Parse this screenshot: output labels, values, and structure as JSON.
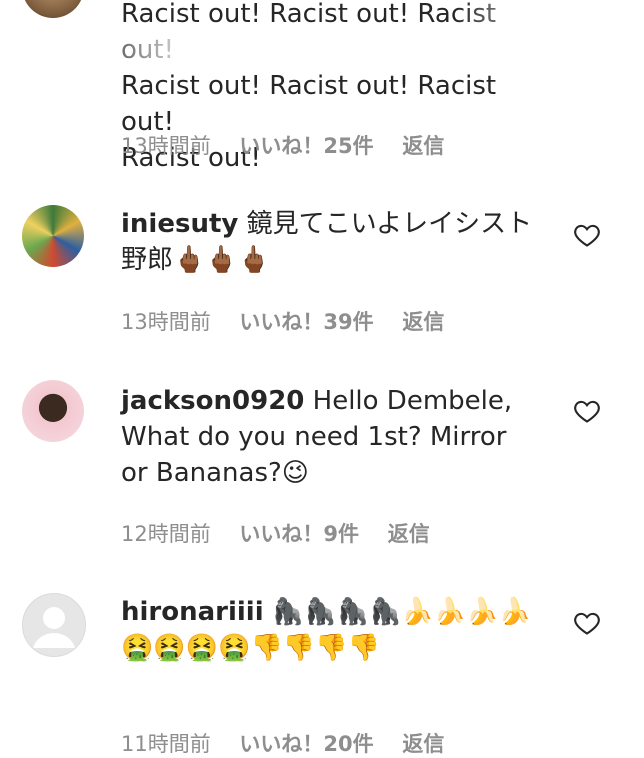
{
  "comments": [
    {
      "lines": [
        "Racist out! Racist out! Racist out!",
        "Racist out! Racist out! Racist out!",
        "Racist out!"
      ],
      "time": "13時間前",
      "likes": "いいね！25件",
      "reply": "返信"
    },
    {
      "username": "iniesuty",
      "text": "鏡見てこいよレイシスト野郎🖕🏾🖕🏾🖕🏾",
      "time": "13時間前",
      "likes": "いいね！39件",
      "reply": "返信"
    },
    {
      "username": "jackson0920",
      "text": "Hello Dembele, What do you need 1st? Mirror or Bananas?😉",
      "time": "12時間前",
      "likes": "いいね！9件",
      "reply": "返信"
    },
    {
      "username": "hironariiii",
      "text": "🦍🦍🦍🦍🍌🍌🍌🍌",
      "text2": "🤮🤮🤮🤮👎👎👎👎",
      "time": "11時間前",
      "likes": "いいね！20件",
      "reply": "返信"
    }
  ],
  "icons": {
    "like": "heart-outline-icon"
  }
}
